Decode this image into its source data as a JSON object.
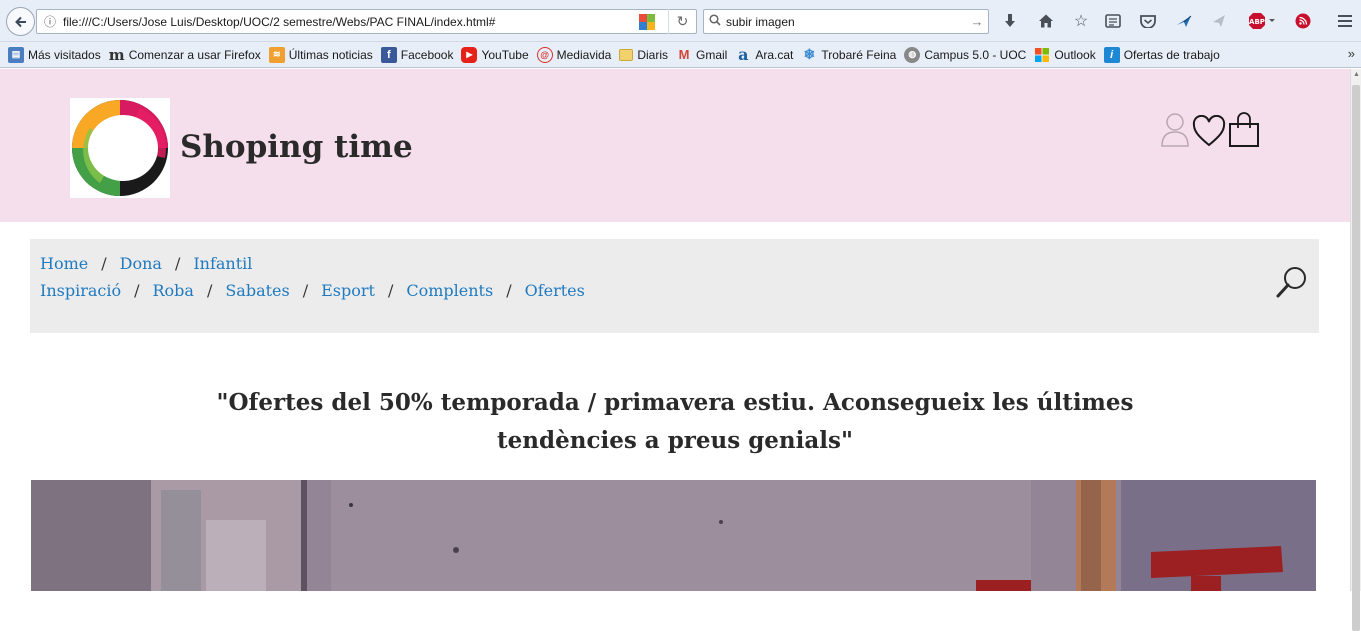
{
  "browser": {
    "url": "file:///C:/Users/Jose Luis/Desktop/UOC/2 semestre/Webs/PAC FINAL/index.html#",
    "search_value": "subir imagen",
    "bookmarks": [
      {
        "label": "Más visitados",
        "icon": "most-visited-icon",
        "color": "#4a7ec0"
      },
      {
        "label": "Comenzar a usar Firefox",
        "icon": "mozilla-m-icon",
        "color": "#333333"
      },
      {
        "label": "Últimas noticias",
        "icon": "rss-feed-icon",
        "color": "#f0a030"
      },
      {
        "label": "Facebook",
        "icon": "facebook-icon",
        "color": "#3b5998"
      },
      {
        "label": "YouTube",
        "icon": "youtube-icon",
        "color": "#e62117"
      },
      {
        "label": "Mediavida",
        "icon": "mediavida-icon",
        "color": "#d9302a"
      },
      {
        "label": "Diaris",
        "icon": "folder-icon",
        "color": "#f2d36b"
      },
      {
        "label": "Gmail",
        "icon": "gmail-icon",
        "color": "#d44638"
      },
      {
        "label": "Ara.cat",
        "icon": "ara-icon",
        "color": "#1a5fa0"
      },
      {
        "label": "Trobaré Feina",
        "icon": "snowflake-icon",
        "color": "#3a8ad0"
      },
      {
        "label": "Campus 5.0 - UOC",
        "icon": "globe-icon",
        "color": "#777777"
      },
      {
        "label": "Outlook",
        "icon": "windows-icon",
        "color": "#f25022"
      },
      {
        "label": "Ofertas de trabajo",
        "icon": "infojobs-icon",
        "color": "#1e88d4"
      }
    ]
  },
  "header": {
    "site_title": "Shoping time",
    "icons": [
      "user-icon",
      "heart-icon",
      "shopping-bag-icon"
    ]
  },
  "menu": {
    "row1": [
      "Home",
      "Dona",
      "Infantil"
    ],
    "row2": [
      "Inspiració",
      "Roba",
      "Sabates",
      "Esport",
      "Complents",
      "Ofertes"
    ],
    "separator": "/"
  },
  "promo": {
    "text": "\"Ofertes del 50% temporada / primavera estiu. Aconsegueix les últimes tendències a preus genials\""
  },
  "colors": {
    "header_bg": "#f6dfec",
    "menu_bg": "#ececec",
    "link": "#1f7ac0"
  }
}
